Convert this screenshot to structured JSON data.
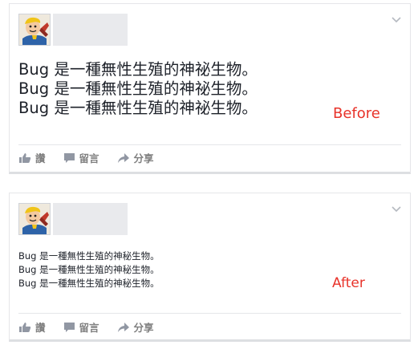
{
  "colors": {
    "label_red": "#e8332a",
    "action_gray": "#7f7f7f",
    "text": "#1d2129",
    "card_border": "#dddfe2"
  },
  "before_card": {
    "text_lines": [
      "Bug 是一種無性生殖的神祕生物。",
      "Bug 是一種無性生殖的神祕生物。",
      "Bug 是一種無性生殖的神祕生物。"
    ],
    "label": "Before",
    "actions": {
      "like": "讚",
      "comment": "留言",
      "share": "分享"
    },
    "icons": [
      "avatar",
      "chevron-down-icon",
      "thumbs-up-icon",
      "comment-icon",
      "share-arrow-icon"
    ]
  },
  "after_card": {
    "text_lines": [
      "Bug 是一種無性生殖的神秘生物。",
      "Bug 是一種無性生殖的神秘生物。",
      "Bug 是一種無性生殖的神秘生物。"
    ],
    "label": "After",
    "actions": {
      "like": "讚",
      "comment": "留言",
      "share": "分享"
    },
    "icons": [
      "avatar",
      "chevron-down-icon",
      "thumbs-up-icon",
      "comment-icon",
      "share-arrow-icon"
    ]
  }
}
